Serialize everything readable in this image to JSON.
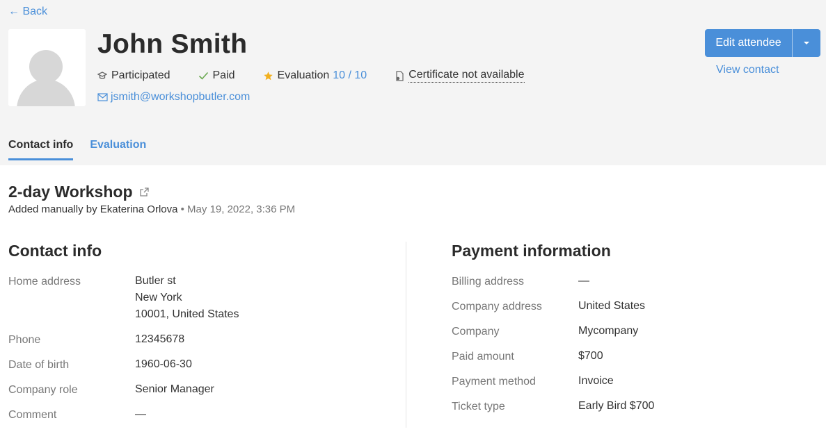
{
  "nav": {
    "back_label": "← Back"
  },
  "attendee": {
    "name": "John Smith",
    "status_participated": "Participated",
    "status_paid": "Paid",
    "evaluation_label": "Evaluation",
    "evaluation_value": "10 / 10",
    "certificate": "Certificate not available",
    "email": "jsmith@workshopbutler.com"
  },
  "actions": {
    "edit_label": "Edit attendee",
    "view_contact_label": "View contact"
  },
  "tabs": [
    {
      "label": "Contact info",
      "active": true
    },
    {
      "label": "Evaluation",
      "active": false
    }
  ],
  "event": {
    "title": "2-day Workshop",
    "added_by": "Added manually by Ekaterina Orlova",
    "added_date": "• May 19, 2022, 3:36 PM"
  },
  "contact_info": {
    "title": "Contact info",
    "fields": [
      {
        "label": "Home address",
        "value_lines": [
          "Butler st",
          "New York",
          "10001, United States"
        ]
      },
      {
        "label": "Phone",
        "value": "12345678"
      },
      {
        "label": "Date of birth",
        "value": "1960-06-30"
      },
      {
        "label": "Company role",
        "value": "Senior Manager"
      },
      {
        "label": "Comment",
        "value": "—"
      }
    ]
  },
  "payment_info": {
    "title": "Payment information",
    "fields": [
      {
        "label": "Billing address",
        "value": "—"
      },
      {
        "label": "Company address",
        "value": "United States"
      },
      {
        "label": "Company",
        "value": "Mycompany"
      },
      {
        "label": "Paid amount",
        "value": "$700"
      },
      {
        "label": "Payment method",
        "value": "Invoice"
      },
      {
        "label": "Ticket type",
        "value": "Early Bird $700"
      }
    ]
  },
  "colors": {
    "accent": "#4a8fd9",
    "paid_check": "#6aa84f",
    "star": "#f2b01e",
    "header_bg": "#f4f4f4"
  },
  "icons": {
    "participated": "graduation-cap-icon",
    "paid": "check-icon",
    "evaluation": "star-icon",
    "certificate": "certificate-icon",
    "email": "envelope-icon",
    "event_link": "external-link-icon",
    "edit_menu": "caret-down-icon"
  }
}
